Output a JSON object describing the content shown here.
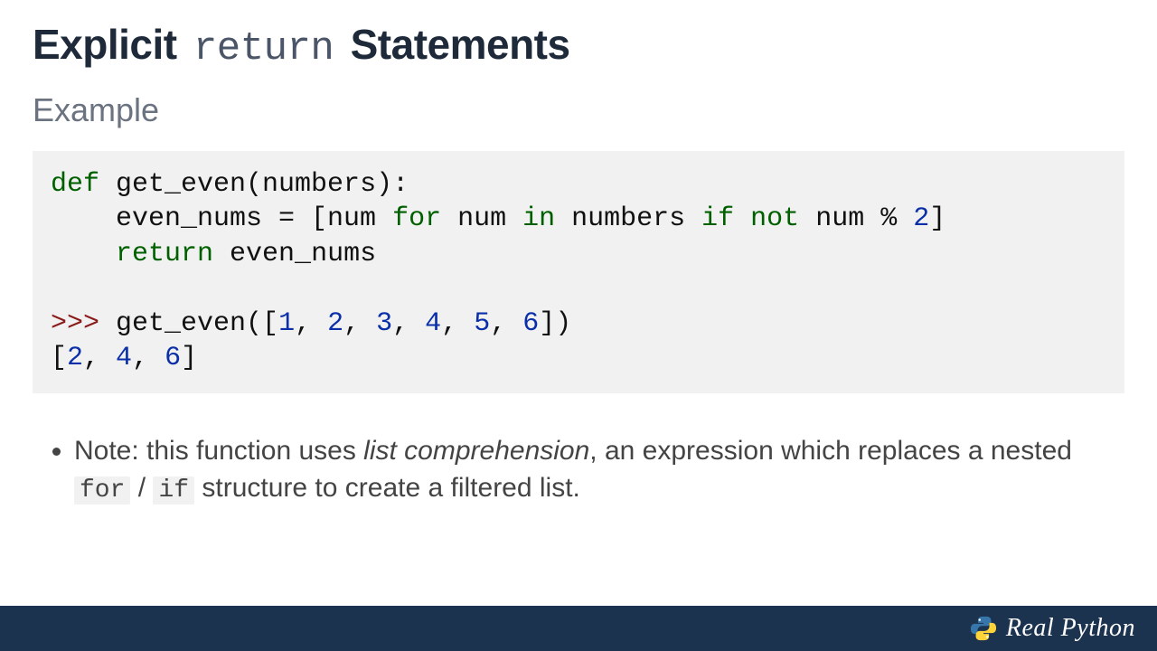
{
  "title": {
    "pre": "Explicit",
    "kw": "return",
    "post": "Statements"
  },
  "subtitle": "Example",
  "code": {
    "l1_def": "def",
    "l1_rest": " get_even(numbers):",
    "l2_a": "    even_nums = [num ",
    "l2_for": "for",
    "l2_b": " num ",
    "l2_in": "in",
    "l2_c": " numbers ",
    "l2_if": "if",
    "l2_d": " ",
    "l2_not": "not",
    "l2_e": " num % ",
    "l2_two": "2",
    "l2_f": "]",
    "l3_a": "    ",
    "l3_ret": "return",
    "l3_b": " even_nums",
    "l5_prompt": ">>>",
    "l5_call_a": " get_even([",
    "l5_n1": "1",
    "l5_s1": ", ",
    "l5_n2": "2",
    "l5_s2": ", ",
    "l5_n3": "3",
    "l5_s3": ", ",
    "l5_n4": "4",
    "l5_s4": ", ",
    "l5_n5": "5",
    "l5_s5": ", ",
    "l5_n6": "6",
    "l5_call_b": "])",
    "l6_a": "[",
    "l6_n1": "2",
    "l6_s1": ", ",
    "l6_n2": "4",
    "l6_s2": ", ",
    "l6_n3": "6",
    "l6_b": "]"
  },
  "note": {
    "a": "Note: this function uses ",
    "em": "list comprehension",
    "b": ", an expression which replaces a nested ",
    "code1": "for",
    "slash": " / ",
    "code2": "if",
    "c": " structure to create a filtered list."
  },
  "brand": "Real Python",
  "logo": {
    "blue": "#3776AB",
    "yellow": "#FFD43B"
  }
}
